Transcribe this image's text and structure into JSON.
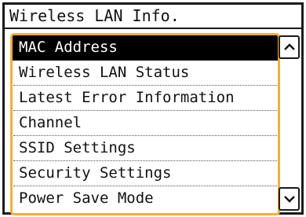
{
  "screen": {
    "title": "Wireless LAN Info."
  },
  "menu": {
    "items": [
      {
        "label": "MAC Address",
        "selected": true
      },
      {
        "label": "Wireless LAN Status",
        "selected": false
      },
      {
        "label": "Latest Error Information",
        "selected": false
      },
      {
        "label": "Channel",
        "selected": false
      },
      {
        "label": "SSID Settings",
        "selected": false
      },
      {
        "label": "Security Settings",
        "selected": false
      },
      {
        "label": "Power Save Mode",
        "selected": false
      }
    ]
  },
  "scroll": {
    "up_icon": "chevron-up-icon",
    "down_icon": "chevron-down-icon"
  },
  "colors": {
    "focus_frame": "#f2b035",
    "selected_bg": "#000000",
    "selected_text": "#ffffff"
  }
}
